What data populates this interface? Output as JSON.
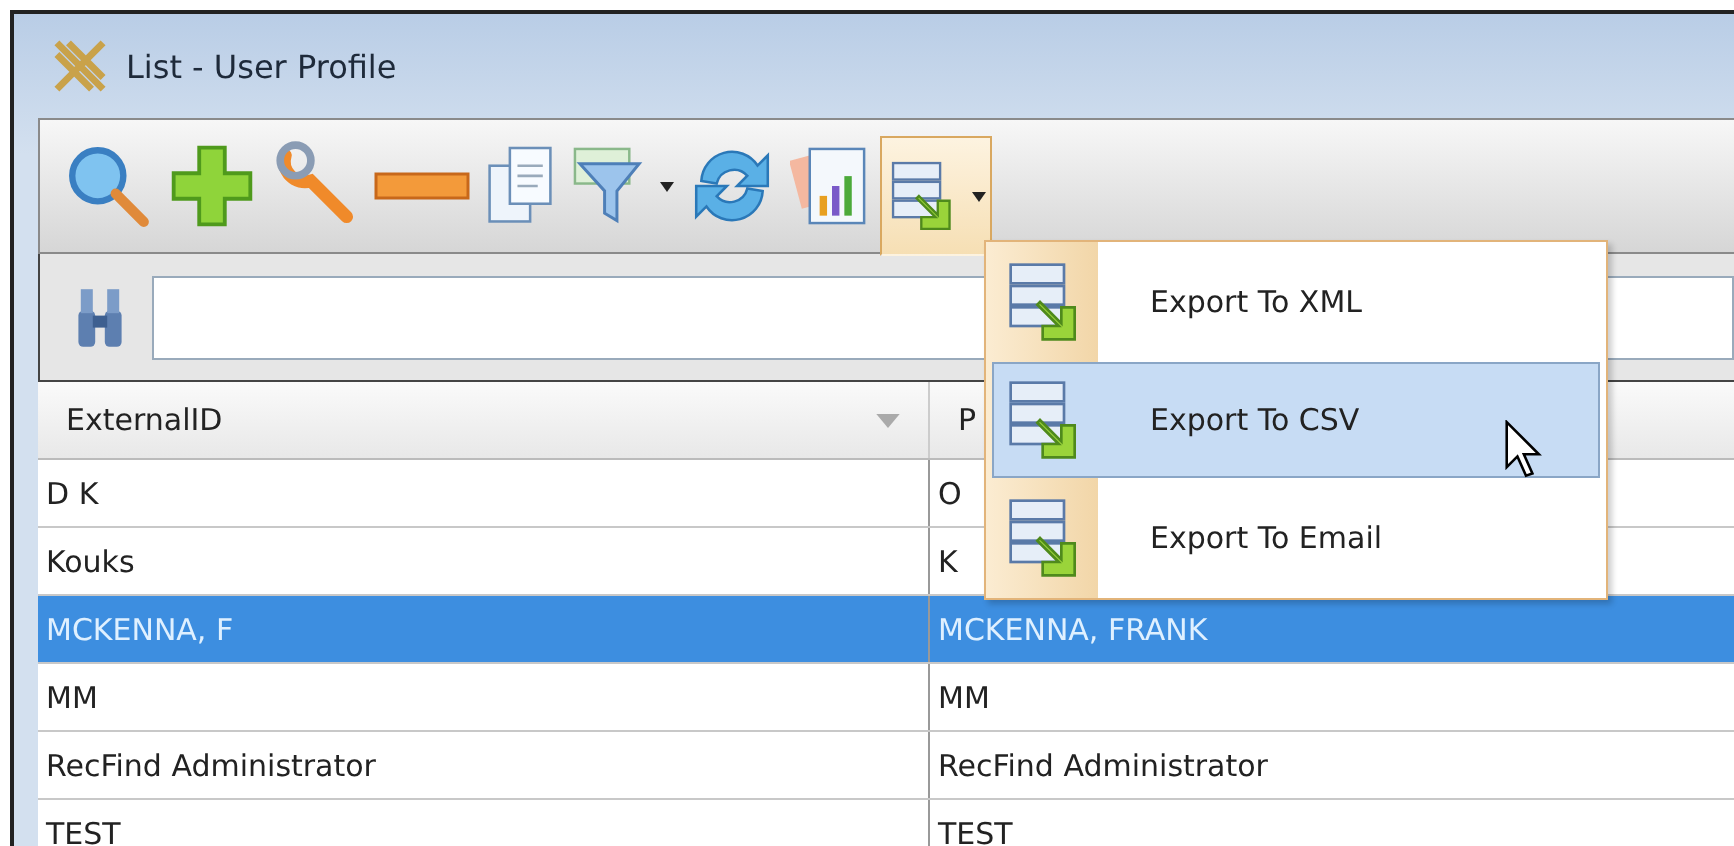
{
  "window": {
    "title": "List - User Profile"
  },
  "toolbar": {
    "export_button": {
      "expanded": true
    }
  },
  "export_menu": {
    "items": [
      {
        "label": "Export To XML",
        "selected": false
      },
      {
        "label": "Export To CSV",
        "selected": true
      },
      {
        "label": "Export To Email",
        "selected": false
      }
    ]
  },
  "table": {
    "columns": [
      "ExternalID",
      "P"
    ],
    "rows": [
      {
        "cells": [
          "D K",
          "O"
        ],
        "selected": false
      },
      {
        "cells": [
          "Kouks",
          "K"
        ],
        "selected": false
      },
      {
        "cells": [
          "MCKENNA, F",
          "MCKENNA, FRANK"
        ],
        "selected": true
      },
      {
        "cells": [
          "MM",
          "MM"
        ],
        "selected": false
      },
      {
        "cells": [
          "RecFind Administrator",
          "RecFind Administrator"
        ],
        "selected": false
      },
      {
        "cells": [
          "TEST",
          "TEST"
        ],
        "selected": false
      }
    ]
  }
}
